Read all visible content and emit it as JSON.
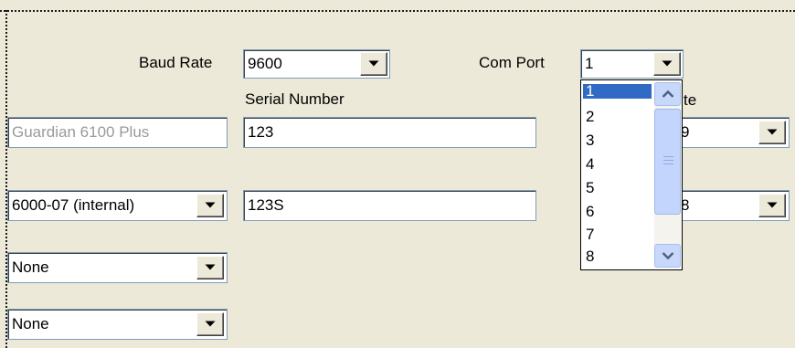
{
  "baud_rate": {
    "label": "Baud Rate",
    "value": "9600"
  },
  "com_port": {
    "label": "Com Port",
    "value": "1",
    "options": [
      "1",
      "2",
      "3",
      "4",
      "5",
      "6",
      "7",
      "8"
    ],
    "selected_index": 0
  },
  "serial_number": {
    "label": "Serial Number"
  },
  "partial_label_right": "te",
  "rows": [
    {
      "device": "Guardian 6100 Plus",
      "serial": "123",
      "right_value": "9"
    },
    {
      "device": "6000-07 (internal)",
      "serial": "123S",
      "right_value": "8"
    },
    {
      "device": "None"
    },
    {
      "device": "None"
    }
  ],
  "colors": {
    "background": "#ece9d8",
    "highlight": "#316ac5",
    "field_border": "#7f9db9"
  }
}
